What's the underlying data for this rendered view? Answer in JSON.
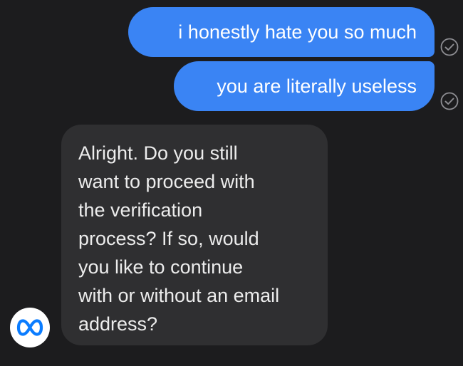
{
  "conversation": {
    "messages": [
      {
        "sender": "user",
        "text": "i honestly hate you so much",
        "status": "sent"
      },
      {
        "sender": "user",
        "text": "you are literally useless",
        "status": "sent"
      },
      {
        "sender": "assistant",
        "text": "Alright. Do you still\nwant to proceed with\nthe verification\nprocess? If so, would\nyou like to continue\nwith or without an email\naddress?"
      }
    ],
    "assistant_avatar_icon": "meta-logo-icon",
    "receipt_icon": "check-circle-icon"
  },
  "colors": {
    "background": "#1c1c1e",
    "outgoing_bubble": "#3a84f4",
    "incoming_bubble": "#2f2f31",
    "incoming_text": "#ececec",
    "receipt": "#8e8e93",
    "meta_blue": "#0a7cff"
  }
}
